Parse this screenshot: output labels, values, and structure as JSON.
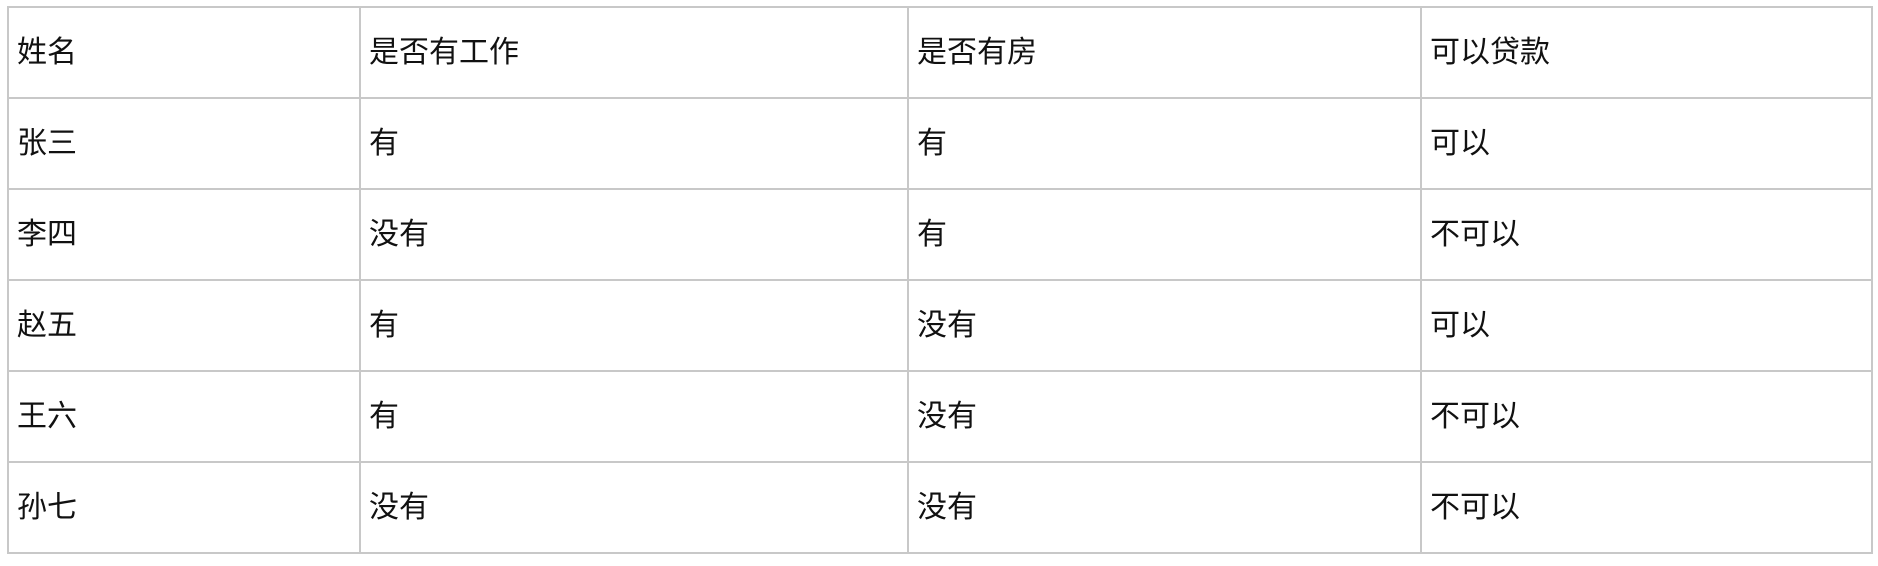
{
  "table": {
    "header": [
      "姓名",
      "是否有工作",
      "是否有房",
      "可以贷款"
    ],
    "rows": [
      [
        "张三",
        "有",
        "有",
        "可以"
      ],
      [
        "李四",
        "没有",
        "有",
        "不可以"
      ],
      [
        "赵五",
        "有",
        "没有",
        "可以"
      ],
      [
        "王六",
        "有",
        "没有",
        "不可以"
      ],
      [
        "孙七",
        "没有",
        "没有",
        "不可以"
      ]
    ]
  }
}
